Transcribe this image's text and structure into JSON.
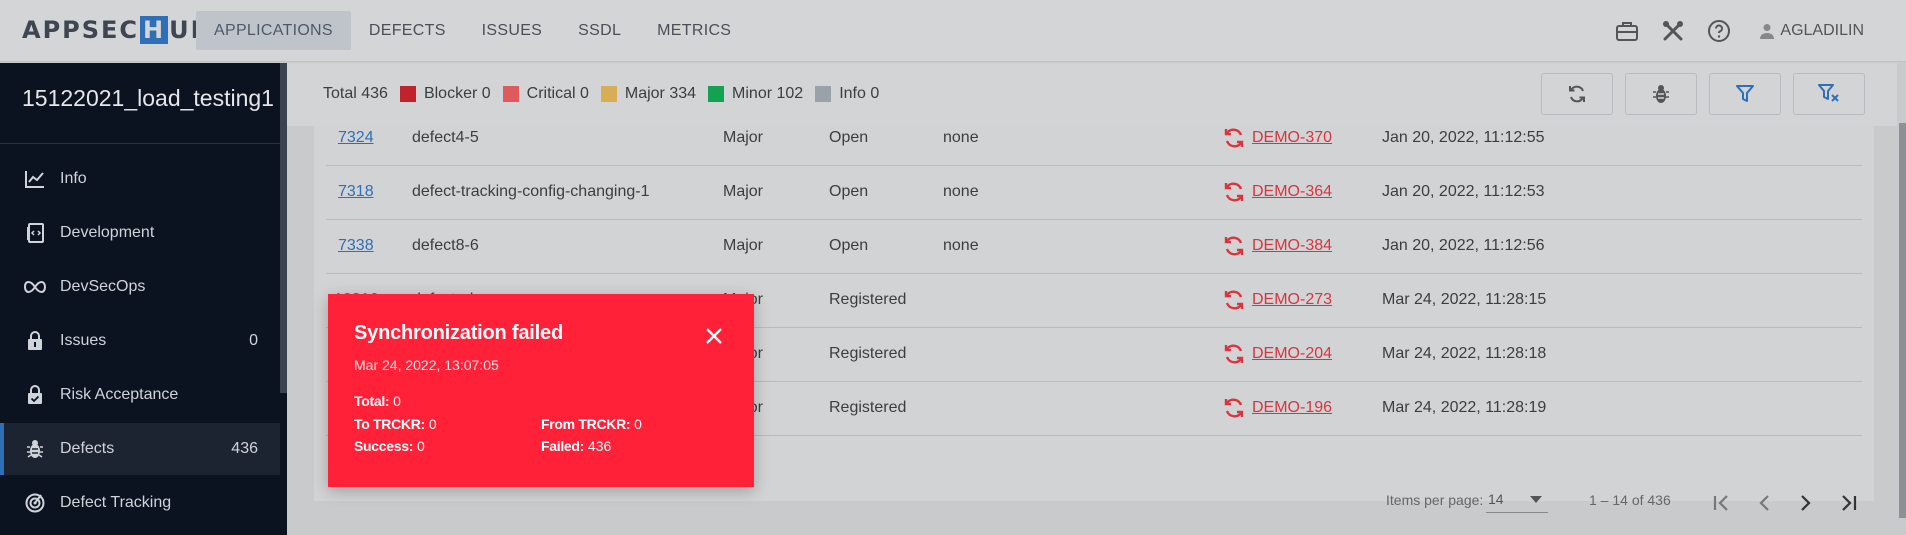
{
  "header": {
    "logo_left": "APPSEC",
    "logo_mid": "H",
    "logo_right": "UB",
    "nav": [
      "APPLICATIONS",
      "DEFECTS",
      "ISSUES",
      "SSDL",
      "METRICS"
    ],
    "active_nav": "APPLICATIONS",
    "user": "AGLADILIN"
  },
  "sidebar": {
    "project": "15122021_load_testing1",
    "items": [
      {
        "label": "Info",
        "count": "",
        "icon": "chart-line-icon"
      },
      {
        "label": "Development",
        "count": "",
        "icon": "code-doc-icon"
      },
      {
        "label": "DevSecOps",
        "count": "",
        "icon": "infinity-icon"
      },
      {
        "label": "Issues",
        "count": "0",
        "icon": "lock-icon"
      },
      {
        "label": "Risk Acceptance",
        "count": "",
        "icon": "lock-check-icon"
      },
      {
        "label": "Defects",
        "count": "436",
        "icon": "bug-icon"
      },
      {
        "label": "Defect Tracking",
        "count": "",
        "icon": "radar-icon"
      }
    ],
    "active": "Defects"
  },
  "legend": {
    "total": "Total 436",
    "items": [
      {
        "label": "Blocker 0",
        "color": "#c0232c"
      },
      {
        "label": "Critical 0",
        "color": "#de5a5c"
      },
      {
        "label": "Major 334",
        "color": "#d9ad53"
      },
      {
        "label": "Minor 102",
        "color": "#12a251"
      },
      {
        "label": "Info 0",
        "color": "#9aa1a8"
      }
    ]
  },
  "rows": [
    {
      "id": "7324",
      "name": "defect4-5",
      "severity": "Major",
      "status": "Open",
      "extra": "none",
      "ticket": "DEMO-370",
      "date": "Jan 20, 2022, 11:12:55"
    },
    {
      "id": "7318",
      "name": "defect-tracking-config-changing-1",
      "severity": "Major",
      "status": "Open",
      "extra": "none",
      "ticket": "DEMO-364",
      "date": "Jan 20, 2022, 11:12:53"
    },
    {
      "id": "7338",
      "name": "defect8-6",
      "severity": "Major",
      "status": "Open",
      "extra": "none",
      "ticket": "DEMO-384",
      "date": "Jan 20, 2022, 11:12:56"
    },
    {
      "id": "12316",
      "name": "defect_dva",
      "severity": "Major",
      "status": "Registered",
      "extra": "",
      "ticket": "DEMO-273",
      "date": "Mar 24, 2022, 11:28:15"
    },
    {
      "id": "",
      "name": "",
      "severity": "Major",
      "status": "Registered",
      "extra": "",
      "ticket": "DEMO-204",
      "date": "Mar 24, 2022, 11:28:18"
    },
    {
      "id": "",
      "name": "",
      "severity": "Major",
      "status": "Registered",
      "extra": "",
      "ticket": "DEMO-196",
      "date": "Mar 24, 2022, 11:28:19"
    }
  ],
  "pagination": {
    "items_per_page_label": "Items per page:",
    "items_per_page": "14",
    "range": "1 – 14 of 436"
  },
  "toast": {
    "title": "Synchronization failed",
    "time": "Mar 24, 2022, 13:07:05",
    "total_label": "Total:",
    "total": "0",
    "to_label": "To TRCKR:",
    "to": "0",
    "from_label": "From TRCKR:",
    "from": "0",
    "success_label": "Success:",
    "success": "0",
    "failed_label": "Failed:",
    "failed": "436"
  }
}
